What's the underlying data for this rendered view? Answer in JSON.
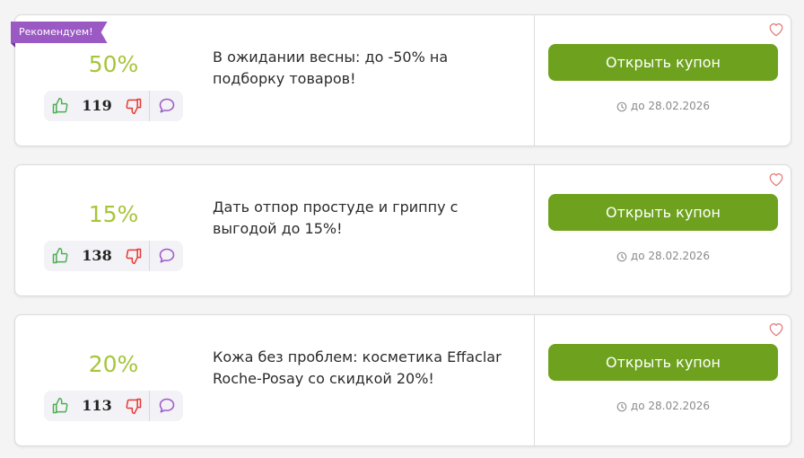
{
  "recommended_badge": "Рекомендуем!",
  "open_button_label": "Открыть купон",
  "colors": {
    "discount": "#a6c53a",
    "button": "#6ea21e",
    "badge": "#9b59c4",
    "thumb_up": "#4caf50",
    "thumb_down": "#e53935",
    "comment": "#9b59c4",
    "heart": "#e57373"
  },
  "icons": [
    "thumb-up-icon",
    "thumb-down-icon",
    "comment-icon",
    "heart-icon",
    "clock-icon"
  ],
  "coupons": [
    {
      "discount": "50%",
      "votes": "119",
      "description": "В ожидании весны: до -50% на подборку товаров!",
      "expiry": "до 28.02.2026",
      "recommended": true
    },
    {
      "discount": "15%",
      "votes": "138",
      "description": "Дать отпор простуде и гриппу с выгодой до 15%!",
      "expiry": "до 28.02.2026",
      "recommended": false
    },
    {
      "discount": "20%",
      "votes": "113",
      "description": "Кожа без проблем: косметика Effaclar Roche-Posay со скидкой 20%!",
      "expiry": "до 28.02.2026",
      "recommended": false
    }
  ]
}
